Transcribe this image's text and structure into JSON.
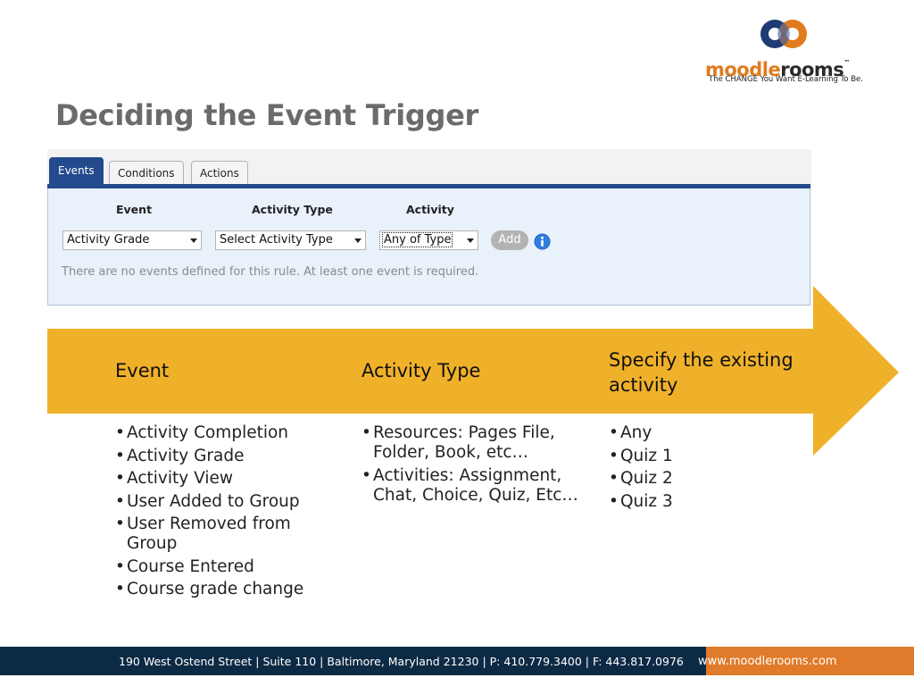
{
  "logo": {
    "word_part1": "moodle",
    "word_part2": "rooms",
    "tm": "™",
    "tagline": "The CHANGE You Want E-Learning To Be.",
    "colors": {
      "orange": "#e07b1e",
      "navy": "#1f3b73",
      "dark": "#2b2b2b"
    }
  },
  "title": "Deciding the Event Trigger",
  "panel": {
    "tabs": [
      {
        "label": "Events",
        "active": true
      },
      {
        "label": "Conditions",
        "active": false
      },
      {
        "label": "Actions",
        "active": false
      }
    ],
    "columns": {
      "event": "Event",
      "activity_type": "Activity Type",
      "activity": "Activity"
    },
    "selects": {
      "event": "Activity Grade",
      "activity_type": "Select Activity Type",
      "activity": "Any of Type"
    },
    "add_button": "Add",
    "empty_message": "There are no events defined for this rule. At least one event is required.",
    "accent_color": "#234a8c"
  },
  "arrow": {
    "color": "#f0b12a",
    "headers": {
      "event": "Event",
      "activity_type": "Activity Type",
      "specify": "Specify the existing activity"
    }
  },
  "lists": {
    "event": [
      "Activity Completion",
      "Activity Grade",
      "Activity View",
      "User Added to Group",
      "User Removed from Group",
      "Course Entered",
      "Course grade change"
    ],
    "activity_type": [
      "Resources: Pages File, Folder, Book, etc…",
      "Activities: Assignment, Chat, Choice, Quiz, Etc…"
    ],
    "activity": [
      "Any",
      "Quiz 1",
      "Quiz 2",
      "Quiz 3"
    ]
  },
  "footer": {
    "address": "190 West Ostend Street | Suite 110 | Baltimore, Maryland 21230 | P: 410.779.3400 | F: 443.817.0976",
    "url": "www.moodlerooms.com",
    "colors": {
      "navy": "#0d2a45",
      "orange": "#e07b2b"
    }
  }
}
